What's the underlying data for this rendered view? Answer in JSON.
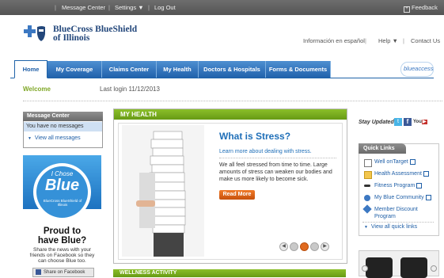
{
  "topbar": {
    "message_center": "Message Center",
    "settings": "Settings",
    "log_out": "Log Out",
    "feedback": "Feedback",
    "feedback_icon": "plus-box-icon"
  },
  "header": {
    "brand_line1": "BlueCross BlueShield",
    "brand_line2": "of Illinois",
    "spanish_link": "Información en español",
    "help": "Help",
    "contact_us": "Contact Us",
    "blueaccess_logo": "blueaccess"
  },
  "nav": {
    "tabs": [
      {
        "label": "Home"
      },
      {
        "label": "My Coverage"
      },
      {
        "label": "Claims Center"
      },
      {
        "label": "My Health"
      },
      {
        "label": "Doctors & Hospitals"
      },
      {
        "label": "Forms & Documents"
      }
    ]
  },
  "welcome": {
    "title": "Welcome",
    "last_login": "Last login 11/12/2013"
  },
  "message_center": {
    "title": "Message Center",
    "no_messages": "You have no messages",
    "view_all": "View all messages"
  },
  "promo": {
    "badge_top": "I Chose",
    "badge_main": "Blue",
    "badge_sub": "BlueCross BlueShield of Illinois",
    "headline_1": "Proud to",
    "headline_2": "have Blue?",
    "body_1": "Share the news with your",
    "body_2": "friends on Facebook so they",
    "body_3": "can choose Blue too.",
    "share_button": "Share on Facebook"
  },
  "my_health": {
    "section_title": "MY HEALTH",
    "article_title": "What is Stress?",
    "subtitle": "Learn more about dealing with stress.",
    "body_1": "We all feel stressed from time to time. Large",
    "body_2": "amounts of stress can weaken our bodies and",
    "body_3": "make us more likely to become sick.",
    "read_more": "Read More",
    "pager_active_index": 2,
    "pager_total": 3
  },
  "next_section": {
    "title": "WELLNESS ACTIVITY"
  },
  "stay_updated": {
    "label": "Stay Updated",
    "icons": [
      "twitter-icon",
      "facebook-icon",
      "youtube-icon"
    ]
  },
  "quick_links": {
    "title": "Quick Links",
    "items": [
      {
        "label": "Well onTarget",
        "icon": "document-icon"
      },
      {
        "label": "Health Assessment",
        "icon": "folder-icon"
      },
      {
        "label": "Fitness Program",
        "icon": "dumbbell-icon"
      },
      {
        "label": "My Blue Community",
        "icon": "people-icon"
      },
      {
        "label": "Member Discount Program",
        "icon": "tag-icon"
      }
    ],
    "view_all": "View all quick links"
  },
  "colors": {
    "brand_blue": "#23477b",
    "nav_blue": "#2162ac",
    "health_green": "#6f9f17",
    "orange": "#e0661d",
    "promo_blue": "#2f8fd6"
  }
}
